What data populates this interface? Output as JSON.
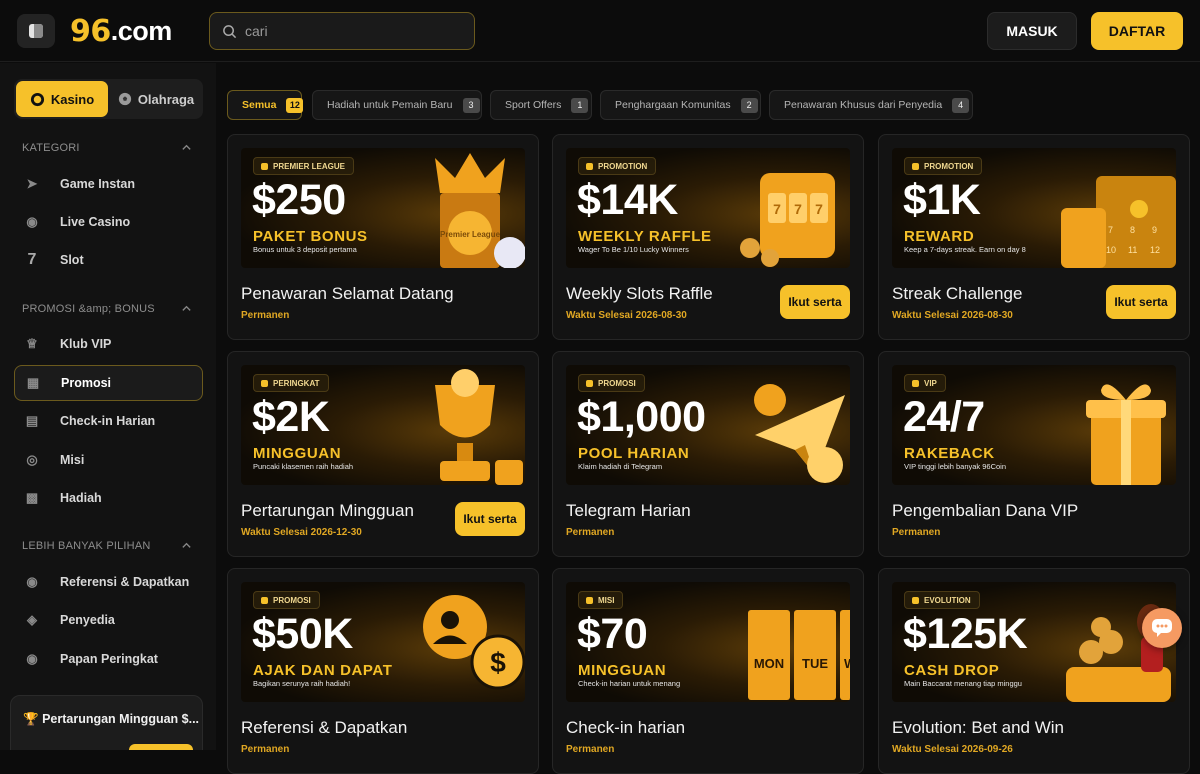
{
  "header": {
    "logo_num": "96",
    "logo_domain": ".com",
    "search_placeholder": "cari",
    "login_label": "MASUK",
    "register_label": "DAFTAR"
  },
  "sidebar": {
    "toggle": {
      "casino": "Kasino",
      "sports": "Olahraga"
    },
    "sections": [
      {
        "title": "KATEGORI",
        "items": [
          "Game Instan",
          "Live Casino",
          "Slot"
        ]
      },
      {
        "title": "PROMOSI &amp; BONUS",
        "items": [
          "Klub VIP",
          "Promosi",
          "Check-in Harian",
          "Misi",
          "Hadiah"
        ]
      },
      {
        "title": "LEBIH BANYAK PILIHAN",
        "items": [
          "Referensi & Dapatkan",
          "Penyedia",
          "Papan Peringkat"
        ]
      }
    ],
    "active_item": "Promosi",
    "bottom_card": {
      "title": "Pertarungan Mingguan $..."
    }
  },
  "filters": [
    {
      "label": "Semua",
      "count": "12",
      "active": true
    },
    {
      "label": "Hadiah untuk Pemain Baru",
      "count": "3"
    },
    {
      "label": "Sport Offers",
      "count": "1"
    },
    {
      "label": "Penghargaan Komunitas",
      "count": "2"
    },
    {
      "label": "Penawaran Khusus dari Penyedia",
      "count": "4"
    }
  ],
  "cards": [
    {
      "tag": "PREMIER LEAGUE",
      "amount": "$250",
      "headline": "PAKET BONUS",
      "desc": "Bonus untuk 3 deposit pertama",
      "title": "Penawaran Selamat Datang",
      "sub": "Permanen",
      "join": ""
    },
    {
      "tag": "PROMOTION",
      "amount": "$14K",
      "headline": "WEEKLY RAFFLE",
      "desc": "Wager To Be 1/10 Lucky Winners",
      "title": "Weekly Slots Raffle",
      "sub": "Waktu Selesai 2026-08-30",
      "join": "Ikut serta"
    },
    {
      "tag": "PROMOTION",
      "amount": "$1K",
      "headline": "REWARD",
      "desc": "Keep a 7-days streak. Earn on day 8",
      "title": "Streak Challenge",
      "sub": "Waktu Selesai 2026-08-30",
      "join": "Ikut serta"
    },
    {
      "tag": "PERINGKAT",
      "amount": "$2K",
      "headline": "MINGGUAN",
      "desc": "Puncaki klasemen raih hadiah",
      "title": "Pertarungan Mingguan",
      "sub": "Waktu Selesai 2026-12-30",
      "join": "Ikut serta"
    },
    {
      "tag": "PROMOSI",
      "amount": "$1,000",
      "headline": "POOL HARIAN",
      "desc": "Klaim hadiah di Telegram",
      "title": "Telegram Harian",
      "sub": "Permanen",
      "join": ""
    },
    {
      "tag": "VIP",
      "amount": "24/7",
      "headline": "RAKEBACK",
      "desc": "VIP tinggi lebih banyak 96Coin",
      "title": "Pengembalian Dana VIP",
      "sub": "Permanen",
      "join": ""
    },
    {
      "tag": "PROMOSI",
      "amount": "$50K",
      "headline": "AJAK DAN DAPAT",
      "desc": "Bagikan serunya raih hadiah!",
      "title": "Referensi & Dapatkan",
      "sub": "Permanen",
      "join": ""
    },
    {
      "tag": "MISI",
      "amount": "$70",
      "headline": "MINGGUAN",
      "desc": "Check-in harian untuk menang",
      "title": "Check-in harian",
      "sub": "Permanen",
      "join": ""
    },
    {
      "tag": "EVOLUTION",
      "amount": "$125K",
      "headline": "CASH DROP",
      "desc": "Main Baccarat menang tiap minggu",
      "title": "Evolution: Bet and Win",
      "sub": "Waktu Selesai 2026-09-26",
      "join": ""
    }
  ],
  "misc": {
    "week_days": [
      "MON",
      "TUE",
      "WE"
    ],
    "calendar_nums": [
      "7",
      "8",
      "9",
      "10",
      "11",
      "12"
    ],
    "pl_label": "Premier League"
  },
  "colors": {
    "accent": "#f6c12a",
    "bg": "#0c0c0c",
    "panel": "#131313"
  }
}
